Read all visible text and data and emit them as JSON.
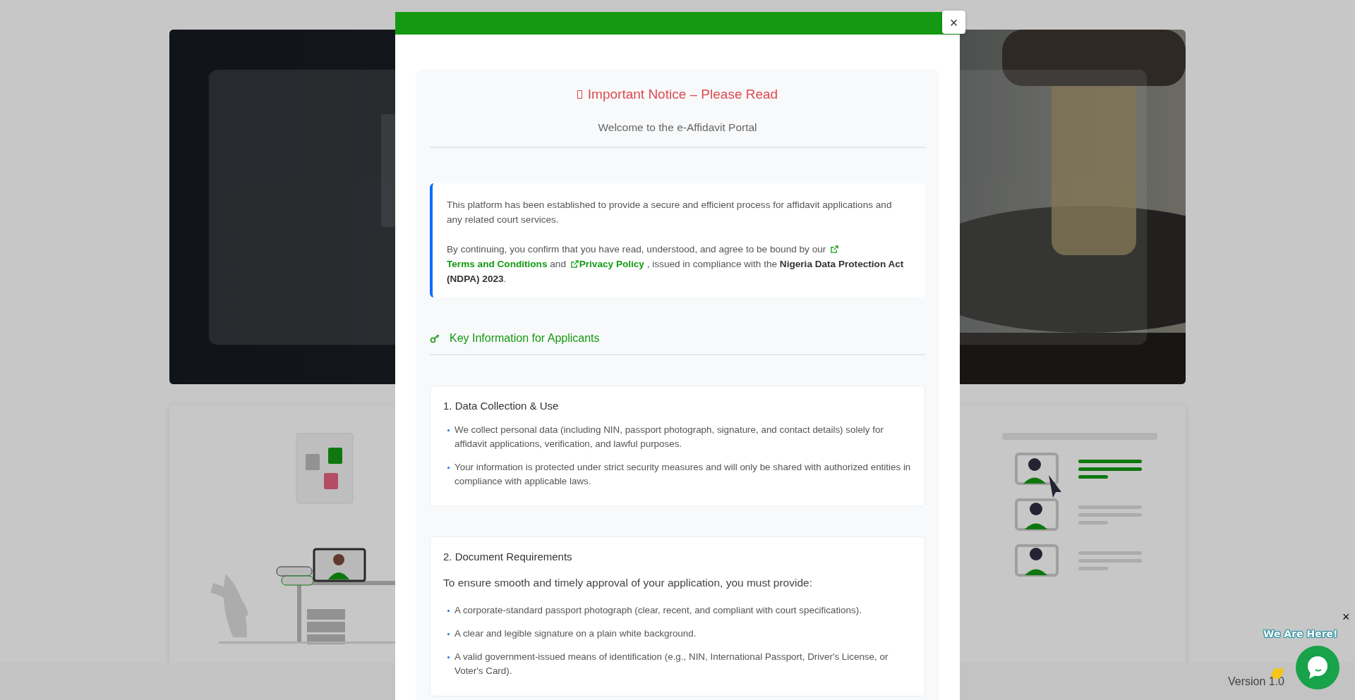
{
  "modal": {
    "close": "×",
    "title": "Important Notice – Please Read",
    "subtitle": "Welcome to the e-Affidavit Portal",
    "intro": [
      {
        "kind": "text",
        "text": "This platform has been established to provide a secure and efficient process for affidavit applications and any related court services."
      },
      {
        "kind": "links",
        "parts": [
          {
            "kind": "text",
            "text": "By continuing, you confirm that you have read, understood, and agree to be bound by our"
          },
          {
            "kind": "link",
            "text": "Terms and Conditions"
          },
          {
            "kind": "text",
            "text": "and"
          },
          {
            "kind": "link",
            "text": "Privacy Policy"
          },
          {
            "kind": "text",
            "text": ", issued in compliance with the **Nigeria Data Protection Act (NDPA) 2023**."
          }
        ]
      }
    ],
    "section_heading": "Key Information for Applicants",
    "sections": [
      {
        "title": "1. Data Collection & Use",
        "bullets": [
          "We collect personal data (including NIN, passport photograph, signature, and contact details) solely for affidavit applications, verification, and lawful purposes.",
          "Your information is protected under strict security measures and will only be shared with authorized entities in compliance with applicable laws."
        ]
      },
      {
        "title": "2. Document Requirements",
        "lead": "To ensure smooth and timely approval of your application, you must provide:",
        "bullets": [
          "A corporate-standard passport photograph (clear, recent, and compliant with court specifications).",
          "A clear and legible signature on a plain white background.",
          "A valid government-issued means of identification (e.g., NIN, International Passport, Driver's License, or Voter's Card)."
        ]
      }
    ]
  },
  "footer": {
    "version": "Version 1.0"
  },
  "chat": {
    "badge": "We Are Here!",
    "dismiss": "×"
  }
}
